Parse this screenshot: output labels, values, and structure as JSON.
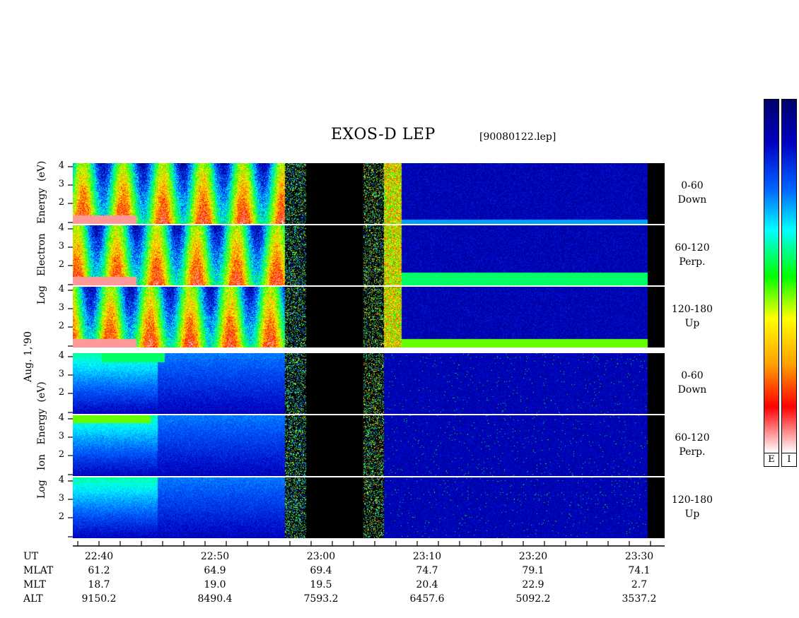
{
  "chart_data": {
    "type": "heatmap",
    "title": "EXOS-D LEP",
    "file_label": "[90080122.lep]",
    "date_label": "Aug. 1,'90",
    "electron_ylabel": [
      "Log",
      "Electron",
      "Energy",
      "(eV)"
    ],
    "ion_ylabel": [
      "Log",
      "Ion",
      "Energy",
      "(eV)"
    ],
    "ytick_labels": [
      "4",
      "3",
      "2"
    ],
    "channels": [
      {
        "range": "0-60",
        "dir": "Down"
      },
      {
        "range": "60-120",
        "dir": "Perp."
      },
      {
        "range": "120-180",
        "dir": "Up"
      }
    ],
    "x_ticks": [
      "22:40",
      "22:50",
      "23:00",
      "23:10",
      "23:20",
      "23:30"
    ],
    "ephemeris": {
      "labels": [
        "UT",
        "MLAT",
        "MLT",
        "ALT"
      ],
      "MLAT": [
        "61.2",
        "64.9",
        "69.4",
        "74.7",
        "79.1",
        "74.1"
      ],
      "MLT": [
        "18.7",
        "19.0",
        "19.5",
        "20.4",
        "22.9",
        "2.7"
      ],
      "ALT": [
        "9150.2",
        "8490.4",
        "7593.2",
        "6457.6",
        "5092.2",
        "3537.2"
      ]
    },
    "colorbar_labels": [
      "E",
      "I"
    ],
    "colorscale": [
      "#ffffff",
      "#ff0000",
      "#ffa000",
      "#ffff00",
      "#00ff00",
      "#00ffff",
      "#0060ff",
      "#0000c0",
      "#00006a"
    ]
  }
}
